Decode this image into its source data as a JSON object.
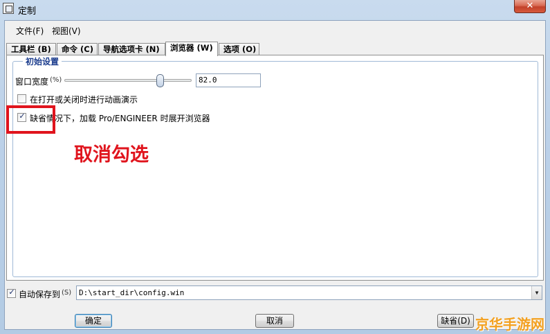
{
  "window": {
    "title": "定制",
    "close_glyph": "✕"
  },
  "menu": [
    "文件(F)",
    "视图(V)"
  ],
  "tabs": [
    {
      "label": "工具栏 (B)",
      "active": false
    },
    {
      "label": "命令 (C)",
      "active": false
    },
    {
      "label": "导航选项卡 (N)",
      "active": false
    },
    {
      "label": "浏览器 (W)",
      "active": true
    },
    {
      "label": "选项 (O)",
      "active": false
    }
  ],
  "browser_tab": {
    "group_title": "初始设置",
    "window_width_label": "窗口宽度",
    "window_width_unit": "(%)",
    "window_width_value": "82.0",
    "slider_fraction": 0.75,
    "animate_label": "在打开或关闭时进行动画演示",
    "animate_checked": false,
    "expand_label": "缺省情况下，加载 Pro/ENGINEER 时展开浏览器",
    "expand_checked": true
  },
  "annotation": {
    "text": "取消勾选",
    "color": "#e0141d"
  },
  "autosave": {
    "label": "自动保存到",
    "shortcut": "(S)",
    "checked": true,
    "path": "D:\\start_dir\\config.win"
  },
  "buttons": {
    "ok": "确定",
    "cancel": "取消",
    "default": "缺省(D)"
  },
  "watermark": {
    "text": "京华手游网",
    "color": "#f3a01f"
  },
  "check_glyph": "✓",
  "icons": {
    "window": "window-icon",
    "close": "close-icon",
    "check": "check-icon",
    "combo": "chevron-down-icon"
  }
}
